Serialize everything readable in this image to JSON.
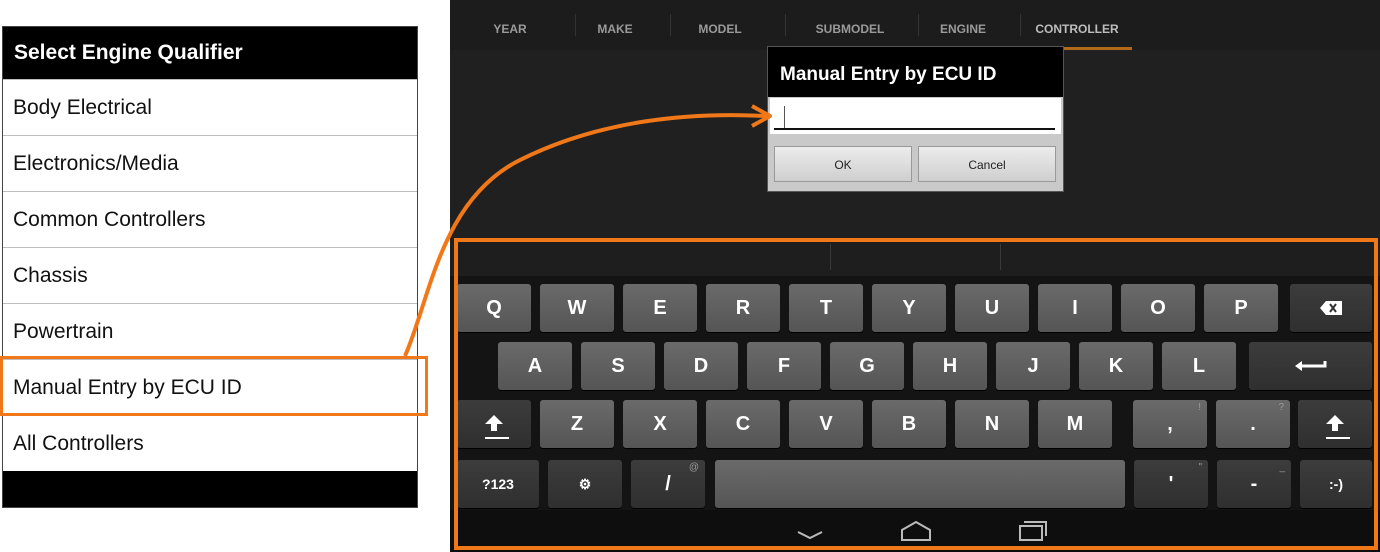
{
  "left_panel": {
    "ghost_tabs": [
      "YEAR",
      "MAKE",
      "ENGINE",
      "CONTROLLER"
    ],
    "header": "Select Engine Qualifier",
    "items": [
      {
        "label": "Body Electrical"
      },
      {
        "label": "Electronics/Media"
      },
      {
        "label": "Common Controllers"
      },
      {
        "label": "Chassis"
      },
      {
        "label": "Powertrain"
      },
      {
        "label": "Manual Entry by ECU ID"
      },
      {
        "label": "All Controllers"
      }
    ]
  },
  "tabs": [
    {
      "label": "YEAR"
    },
    {
      "label": "MAKE"
    },
    {
      "label": "MODEL"
    },
    {
      "label": "SUBMODEL"
    },
    {
      "label": "ENGINE"
    },
    {
      "label": "CONTROLLER"
    }
  ],
  "active_tab": "CONTROLLER",
  "dialog": {
    "title": "Manual Entry by ECU ID",
    "input_value": "",
    "ok_label": "OK",
    "cancel_label": "Cancel"
  },
  "keyboard": {
    "row1": [
      "Q",
      "W",
      "E",
      "R",
      "T",
      "Y",
      "U",
      "I",
      "O",
      "P"
    ],
    "row2": [
      "A",
      "S",
      "D",
      "F",
      "G",
      "H",
      "J",
      "K",
      "L"
    ],
    "row3": [
      "Z",
      "X",
      "C",
      "V",
      "B",
      "N",
      "M"
    ],
    "comma": ",",
    "comma_hint": "!",
    "period": ".",
    "period_hint": "?",
    "symbols_label": "?123",
    "settings_glyph": "⚙",
    "slash": "/",
    "slash_hint": "@",
    "apostrophe": "'",
    "apostrophe_hint": "\"",
    "dash": "-",
    "dash_hint": "_",
    "emoticon": ":-)"
  },
  "annotations": {
    "color": "#f07819"
  },
  "icons": {
    "backspace": "backspace-icon",
    "enter": "enter-icon",
    "shift": "shift-icon",
    "nav_back": "nav-back-icon",
    "nav_home": "nav-home-icon",
    "nav_recents": "nav-recents-icon"
  }
}
